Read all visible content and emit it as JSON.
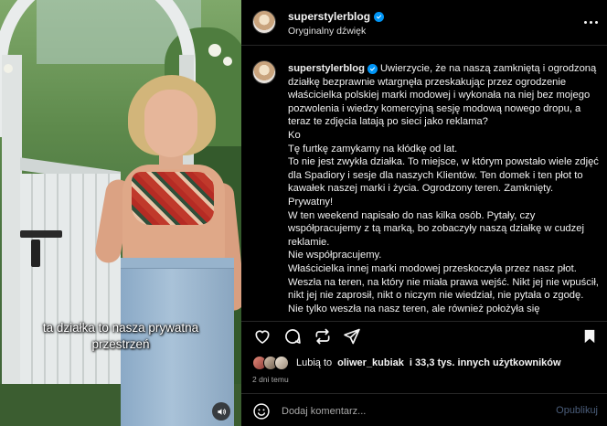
{
  "video": {
    "caption_line1": "ta działka to nasza prywatna",
    "caption_line2": "przestrzeń",
    "sound_icon": "speaker-icon"
  },
  "header": {
    "username": "superstylerblog",
    "audio": "Oryginalny dźwięk"
  },
  "post": {
    "username": "superstylerblog",
    "paragraphs": [
      "Uwierzycie, że na naszą zamkniętą i ogrodzoną działkę bezprawnie wtargnęła przeskakując przez ogrodzenie właścicielka polskiej marki modowej i wykonała na niej bez mojego pozwolenia i wiedzy komercyjną sesję modową nowego dropu, a teraz te zdjęcia latają po sieci jako reklama?",
      "Ko",
      "Tę furtkę zamykamy na kłódkę od lat.",
      "To nie jest zwykła działka. To miejsce, w którym powstało wiele zdjęć dla Spadiory i sesje dla naszych Klientów. Ten domek i ten płot to kawałek naszej marki i życia. Ogrodzony teren. Zamknięty. Prywatny!",
      "W ten weekend napisało do nas kilka osób. Pytały, czy współpracujemy z tą marką, bo zobaczyły naszą działkę w cudzej reklamie.",
      "Nie współpracujemy.",
      "Właścicielka innej marki modowej przeskoczyła przez nasz płot. Weszła na teren, na który nie miała prawa wejść. Nikt jej nie wpuścił, nikt jej nie zaprosił, nikt o niczym nie wiedział, nie pytała o zgodę. Nie tylko weszła na nasz teren, ale również położyła się"
    ]
  },
  "likes": {
    "prefix": "Lubią to",
    "user": "oliwer_kubiak",
    "suffix": "i 33,3 tys. innych użytkowników"
  },
  "date": "2 dni temu",
  "comment": {
    "placeholder": "Dodaj komentarz...",
    "publish": "Opublikuj"
  },
  "colors": {
    "background": "#000000",
    "verified": "#0095f6",
    "publish_disabled": "#4a5d7a",
    "muted_text": "#a8a8a8"
  }
}
